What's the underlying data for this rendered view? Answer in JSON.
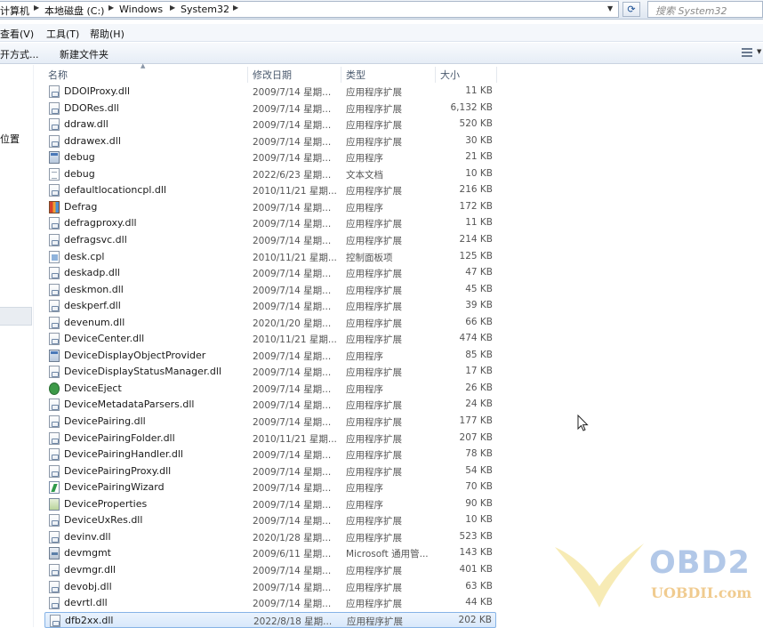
{
  "address": {
    "crumbs": [
      "计算机",
      "本地磁盘 (C:)",
      "Windows",
      "System32"
    ]
  },
  "search": {
    "placeholder": "搜索 System32"
  },
  "menu": [
    "查看(V)",
    "工具(T)",
    "帮助(H)"
  ],
  "toolbar": {
    "open_with": "开方式...",
    "new_folder": "新建文件夹"
  },
  "nav": {
    "partial_label": "位置"
  },
  "columns": {
    "name": "名称",
    "date": "修改日期",
    "type": "类型",
    "size": "大小"
  },
  "rows": [
    {
      "icon": "dll",
      "name": "DDOIProxy.dll",
      "date": "2009/7/14 星期...",
      "type": "应用程序扩展",
      "size": "11 KB"
    },
    {
      "icon": "dll",
      "name": "DDORes.dll",
      "date": "2009/7/14 星期...",
      "type": "应用程序扩展",
      "size": "6,132 KB"
    },
    {
      "icon": "dll",
      "name": "ddraw.dll",
      "date": "2009/7/14 星期...",
      "type": "应用程序扩展",
      "size": "520 KB"
    },
    {
      "icon": "dll",
      "name": "ddrawex.dll",
      "date": "2009/7/14 星期...",
      "type": "应用程序扩展",
      "size": "30 KB"
    },
    {
      "icon": "app",
      "name": "debug",
      "date": "2009/7/14 星期...",
      "type": "应用程序",
      "size": "21 KB"
    },
    {
      "icon": "txt",
      "name": "debug",
      "date": "2022/6/23 星期...",
      "type": "文本文档",
      "size": "10 KB"
    },
    {
      "icon": "dll",
      "name": "defaultlocationcpl.dll",
      "date": "2010/11/21 星期...",
      "type": "应用程序扩展",
      "size": "216 KB"
    },
    {
      "icon": "defrag",
      "name": "Defrag",
      "date": "2009/7/14 星期...",
      "type": "应用程序",
      "size": "172 KB"
    },
    {
      "icon": "dll",
      "name": "defragproxy.dll",
      "date": "2009/7/14 星期...",
      "type": "应用程序扩展",
      "size": "11 KB"
    },
    {
      "icon": "dll",
      "name": "defragsvc.dll",
      "date": "2009/7/14 星期...",
      "type": "应用程序扩展",
      "size": "214 KB"
    },
    {
      "icon": "cpl",
      "name": "desk.cpl",
      "date": "2010/11/21 星期...",
      "type": "控制面板项",
      "size": "125 KB"
    },
    {
      "icon": "dll",
      "name": "deskadp.dll",
      "date": "2009/7/14 星期...",
      "type": "应用程序扩展",
      "size": "47 KB"
    },
    {
      "icon": "dll",
      "name": "deskmon.dll",
      "date": "2009/7/14 星期...",
      "type": "应用程序扩展",
      "size": "45 KB"
    },
    {
      "icon": "dll",
      "name": "deskperf.dll",
      "date": "2009/7/14 星期...",
      "type": "应用程序扩展",
      "size": "39 KB"
    },
    {
      "icon": "dll",
      "name": "devenum.dll",
      "date": "2020/1/20 星期...",
      "type": "应用程序扩展",
      "size": "66 KB"
    },
    {
      "icon": "dll",
      "name": "DeviceCenter.dll",
      "date": "2010/11/21 星期...",
      "type": "应用程序扩展",
      "size": "474 KB"
    },
    {
      "icon": "app",
      "name": "DeviceDisplayObjectProvider",
      "date": "2009/7/14 星期...",
      "type": "应用程序",
      "size": "85 KB"
    },
    {
      "icon": "dll",
      "name": "DeviceDisplayStatusManager.dll",
      "date": "2009/7/14 星期...",
      "type": "应用程序扩展",
      "size": "17 KB"
    },
    {
      "icon": "eject",
      "name": "DeviceEject",
      "date": "2009/7/14 星期...",
      "type": "应用程序",
      "size": "26 KB"
    },
    {
      "icon": "dll",
      "name": "DeviceMetadataParsers.dll",
      "date": "2009/7/14 星期...",
      "type": "应用程序扩展",
      "size": "24 KB"
    },
    {
      "icon": "dll",
      "name": "DevicePairing.dll",
      "date": "2009/7/14 星期...",
      "type": "应用程序扩展",
      "size": "177 KB"
    },
    {
      "icon": "dll",
      "name": "DevicePairingFolder.dll",
      "date": "2010/11/21 星期...",
      "type": "应用程序扩展",
      "size": "207 KB"
    },
    {
      "icon": "dll",
      "name": "DevicePairingHandler.dll",
      "date": "2009/7/14 星期...",
      "type": "应用程序扩展",
      "size": "78 KB"
    },
    {
      "icon": "dll",
      "name": "DevicePairingProxy.dll",
      "date": "2009/7/14 星期...",
      "type": "应用程序扩展",
      "size": "54 KB"
    },
    {
      "icon": "wizard",
      "name": "DevicePairingWizard",
      "date": "2009/7/14 星期...",
      "type": "应用程序",
      "size": "70 KB"
    },
    {
      "icon": "props",
      "name": "DeviceProperties",
      "date": "2009/7/14 星期...",
      "type": "应用程序",
      "size": "90 KB"
    },
    {
      "icon": "dll",
      "name": "DeviceUxRes.dll",
      "date": "2009/7/14 星期...",
      "type": "应用程序扩展",
      "size": "10 KB"
    },
    {
      "icon": "dll",
      "name": "devinv.dll",
      "date": "2020/1/28 星期...",
      "type": "应用程序扩展",
      "size": "523 KB"
    },
    {
      "icon": "mmc",
      "name": "devmgmt",
      "date": "2009/6/11 星期...",
      "type": "Microsoft 通用管...",
      "size": "143 KB"
    },
    {
      "icon": "dll",
      "name": "devmgr.dll",
      "date": "2009/7/14 星期...",
      "type": "应用程序扩展",
      "size": "401 KB"
    },
    {
      "icon": "dll",
      "name": "devobj.dll",
      "date": "2009/7/14 星期...",
      "type": "应用程序扩展",
      "size": "63 KB"
    },
    {
      "icon": "dll",
      "name": "devrtl.dll",
      "date": "2009/7/14 星期...",
      "type": "应用程序扩展",
      "size": "44 KB"
    },
    {
      "icon": "dll",
      "name": "dfb2xx.dll",
      "date": "2022/8/18 星期...",
      "type": "应用程序扩展",
      "size": "202 KB",
      "selected": true
    }
  ],
  "watermark": {
    "brand": "OBD2",
    "url": "UOBDII.com"
  },
  "colors": {
    "selection": "#d8e8fb",
    "selection_border": "#86b3e6",
    "watermark_blue": "#aac3e6",
    "watermark_orange": "#f0c98a"
  }
}
